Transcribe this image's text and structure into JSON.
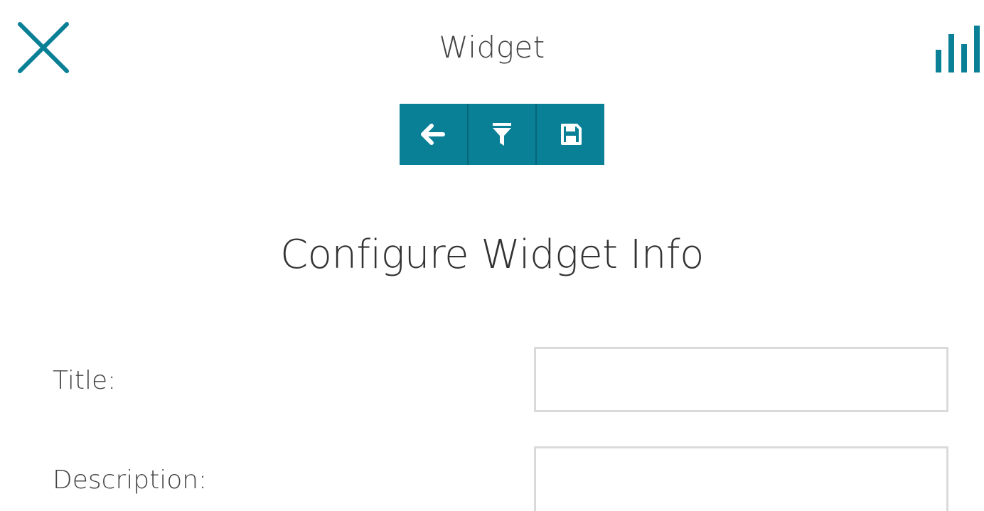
{
  "header": {
    "title": "Widget",
    "close_icon": "close-icon",
    "stats_icon": "bar-chart-icon"
  },
  "toolbar": {
    "buttons": [
      {
        "icon": "arrow-left-icon"
      },
      {
        "icon": "filter-icon"
      },
      {
        "icon": "save-icon"
      }
    ]
  },
  "main": {
    "section_title": "Configure Widget Info",
    "fields": [
      {
        "label": "Title:",
        "value": "",
        "placeholder": ""
      },
      {
        "label": "Description:",
        "value": "",
        "placeholder": ""
      }
    ]
  },
  "colors": {
    "accent": "#0a8097",
    "text": "#444444",
    "input_border": "#dadada"
  }
}
